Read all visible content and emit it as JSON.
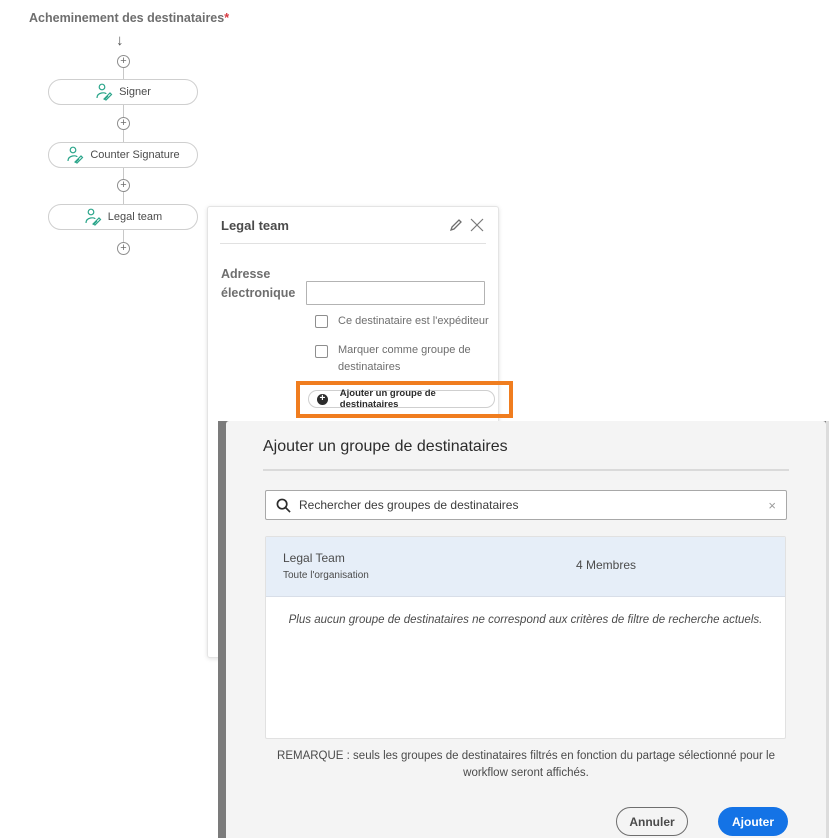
{
  "routing": {
    "title": "Acheminement des destinataires",
    "required_marker": "*",
    "nodes": [
      {
        "label": "Signer",
        "icon": "user-sign-icon"
      },
      {
        "label": "Counter Signature",
        "icon": "user-sign-icon"
      },
      {
        "label": "Legal team",
        "icon": "user-sign-icon"
      }
    ],
    "add_step_glyph": "+",
    "arrow_glyph": "↓"
  },
  "panel": {
    "title": "Legal team",
    "email_label_line1": "Adresse",
    "email_label_line2": "électronique",
    "email_value": "",
    "checkbox_sender": {
      "label": "Ce destinataire est l'expéditeur",
      "checked": false
    },
    "checkbox_group_line1": "Marquer comme groupe de",
    "checkbox_group_line2": "destinataires",
    "checkbox_group_checked": false,
    "add_group_button": "Ajouter un groupe de destinataires",
    "highlight_color": "#f07d1f"
  },
  "modal": {
    "title": "Ajouter un groupe de destinataires",
    "search": {
      "placeholder": "Rechercher des groupes de destinataires",
      "value": "",
      "clear_glyph": "×"
    },
    "groups": [
      {
        "name": "Legal Team",
        "scope": "Toute l'organisation",
        "members": "4 Membres",
        "selected": true
      }
    ],
    "empty_message": "Plus aucun groupe de destinataires ne correspond aux critères de filtre de recherche actuels.",
    "note": "REMARQUE : seuls les groupes de destinataires filtrés en fonction du partage sélectionné pour le workflow seront affichés.",
    "cancel_label": "Annuler",
    "add_label": "Ajouter",
    "accent_color": "#1473e6"
  }
}
